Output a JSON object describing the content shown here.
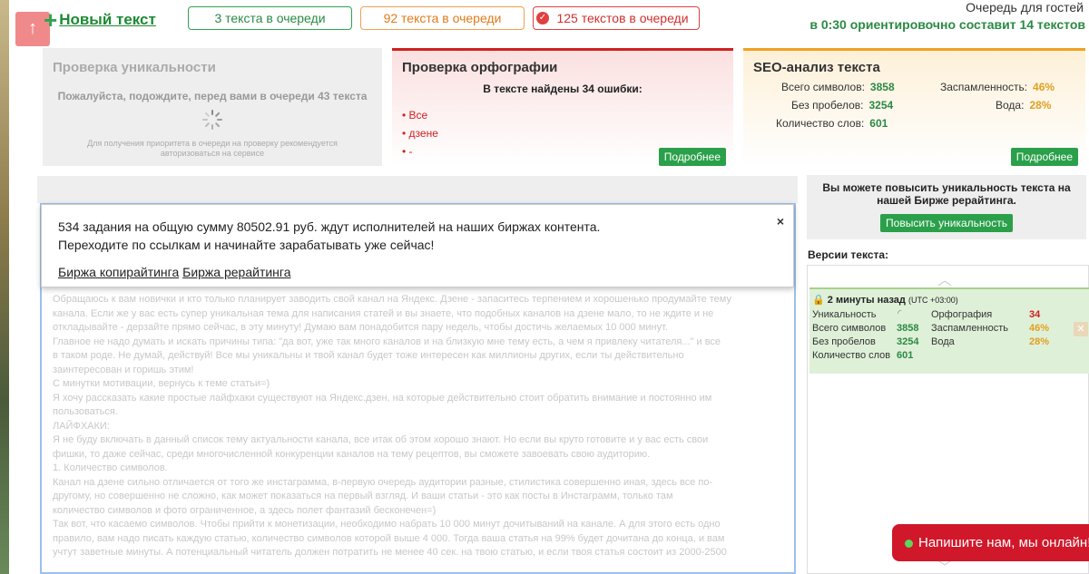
{
  "header": {
    "up_icon": "arrow-up-icon",
    "new_text_icon": "plus-icon",
    "new_text": "Новый текст",
    "queues": [
      "3 текста в очереди",
      "92 текста в очереди",
      "125 текстов в очереди"
    ],
    "guest_queue_line1": "Очередь для гостей",
    "guest_queue_line2": "в 0:30 ориентировочно составит 14 текстов"
  },
  "uniqueness": {
    "title": "Проверка уникальности",
    "wait": "Пожалуйста, подождите, перед вами в очереди 43 текста",
    "note": "Для получения приоритета в очереди на проверку рекомендуется авторизоваться на сервисе"
  },
  "orthography": {
    "title": "Проверка орфографии",
    "found": "В тексте найдены 34 ошибки:",
    "errors": [
      "Все",
      "дзене",
      "-"
    ],
    "more": "Подробнее"
  },
  "seo": {
    "title": "SEO-анализ текста",
    "total_label": "Всего символов:",
    "total": "3858",
    "nospace_label": "Без пробелов:",
    "nospace": "3254",
    "words_label": "Количество слов:",
    "words": "601",
    "spam_label": "Заспамленность:",
    "spam": "46%",
    "water_label": "Вода:",
    "water": "28%",
    "more": "Подробнее"
  },
  "notice": {
    "line1": "534 задания на общую сумму 80502.91 руб. ждут исполнителей на наших биржах контента.",
    "line2": "Переходите по ссылкам и начинайте зарабатывать уже сейчас!",
    "link1": "Биржа копирайтинга",
    "link2": "Биржа рерайтинга",
    "close": "×"
  },
  "editor_lines": [
    "Обращаюсь к вам новички и кто только планирует заводить свой канал на Яндекс. Дзене - запаситесь терпением и хорошенько продумайте тему",
    "канала. Если же у вас есть супер уникальная тема для написания статей и вы знаете, что подобных каналов на дзене мало, то не ждите и не",
    "откладывайте - дерзайте прямо сейчас, в эту минуту! Думаю вам понадобится пару недель, чтобы достичь желаемых 10 000 минут.",
    "Главное не надо думать и искать причины типа: \"да вот, уже так много каналов и на близкую мне тему есть, а чем я привлеку читателя...\" и все",
    "в таком роде. Не думай, действуй! Все мы уникальны и твой канал будет тоже интересен как миллионы других, если ты действительно",
    "заинтересован и горишь этим!",
    "С минутки мотивации, вернусь к теме статьи=)",
    "Я хочу рассказать какие простые лайфхаки существуют на Яндекс.дзен, на которые действительно стоит обратить внимание и постоянно им",
    "пользоваться.",
    "ЛАЙФХАКИ:",
    "Я не буду включать в данный список тему актуальности канала, все итак об этом хорошо знают. Но если вы круто готовите и у вас есть свои",
    "фишки, то даже сейчас, среди многочисленной конкуренции каналов на тему рецептов, вы сможете завоевать свою аудиторию.",
    "1. Количество символов.",
    "Канал на дзене сильно отличается от того же инстаграмма, в-первую очередь аудитории разные, стилистика совершенно иная, здесь все по-",
    "другому, но совершенно не сложно, как может показаться на первый взгляд. И ваши статьи - это как посты в Инстаграмм, только там",
    "количество символов и фото ограниченное, а здесь полет фантазий бесконечен=)",
    "Так вот, что касаемо символов. Чтобы прийти к монетизации, необходимо набрать 10 000 минут дочитываний на канале. А для этого есть одно",
    "правило, вам надо писать каждую статью, количество символов которой выше 4 000. Тогда ваша статья на 99% будет дочитана до конца, и вам",
    "учтут заветные минуты. А потенциальный читатель должен потратить не менее 40 сек. на твою статью, и если твоя статья состоит из 2000-2500"
  ],
  "boost": {
    "text": "Вы можете повысить уникальность текста на нашей Бирже рерайтинга.",
    "button": "Повысить уникальность"
  },
  "versions": {
    "label": "Версии текста:",
    "time": "2 минуты назад",
    "tz": "(UTC +03:00)",
    "uniq_label": "Уникальность",
    "orth_label": "Орфография",
    "orth": "34",
    "total_label": "Всего символов",
    "total": "3858",
    "spam_label": "Заспамленность",
    "spam": "46%",
    "nospace_label": "Без пробелов",
    "nospace": "3254",
    "water_label": "Вода",
    "water": "28%",
    "words_label": "Количество слов",
    "words": "601"
  },
  "chat": {
    "text": "Напишите нам, мы онлайн!"
  },
  "colors": {
    "accent_green": "#2aa04a",
    "error_red": "#d02020",
    "warn_orange": "#e0a020",
    "chat_red": "#d0182a"
  }
}
